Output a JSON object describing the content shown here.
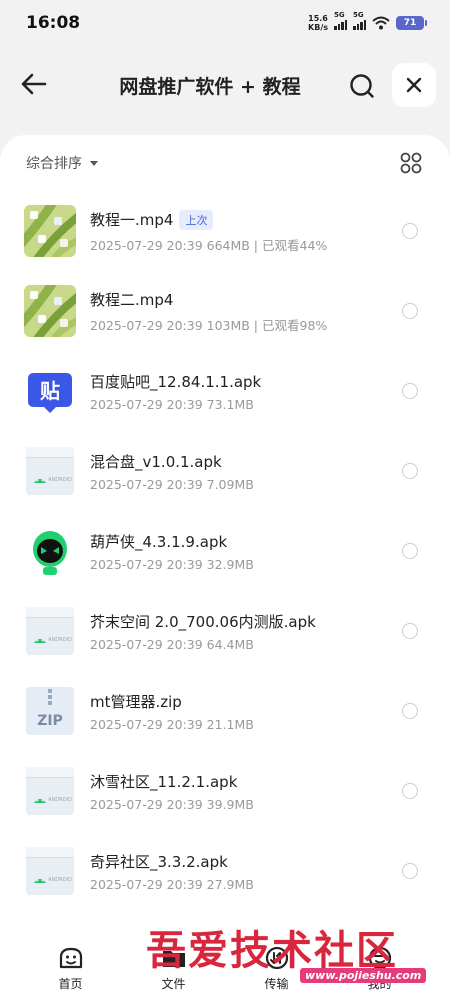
{
  "status": {
    "time": "16:08",
    "net_speed_value": "15.6",
    "net_speed_unit": "KB/s",
    "sim1": "5G",
    "sim2": "5G",
    "battery": "71"
  },
  "header": {
    "title": "网盘推广软件 + 教程"
  },
  "sort": {
    "label": "综合排序"
  },
  "files": [
    {
      "name": "教程一.mp4",
      "tag": "上次",
      "info": "2025-07-29 20:39  664MB | 已观看44%",
      "type": "video"
    },
    {
      "name": "教程二.mp4",
      "tag": "",
      "info": "2025-07-29 20:39  103MB | 已观看98%",
      "type": "video"
    },
    {
      "name": "百度贴吧_12.84.1.1.apk",
      "tag": "",
      "info": "2025-07-29 20:39  73.1MB",
      "type": "tieba"
    },
    {
      "name": "混合盘_v1.0.1.apk",
      "tag": "",
      "info": "2025-07-29 20:39  7.09MB",
      "type": "apk"
    },
    {
      "name": "葫芦侠_4.3.1.9.apk",
      "tag": "",
      "info": "2025-07-29 20:39  32.9MB",
      "type": "huluxia"
    },
    {
      "name": "芥末空间 2.0_700.06内测版.apk",
      "tag": "",
      "info": "2025-07-29 20:39  64.4MB",
      "type": "apk"
    },
    {
      "name": "mt管理器.zip",
      "tag": "",
      "info": "2025-07-29 20:39  21.1MB",
      "type": "zip"
    },
    {
      "name": "沐雪社区_11.2.1.apk",
      "tag": "",
      "info": "2025-07-29 20:39  39.9MB",
      "type": "apk"
    },
    {
      "name": "奇异社区_3.3.2.apk",
      "tag": "",
      "info": "2025-07-29 20:39  27.9MB",
      "type": "apk"
    }
  ],
  "icons": {
    "tieba_glyph": "贴",
    "apk_label": "ANDROID",
    "zip_label": "ZIP"
  },
  "nav": [
    {
      "label": "首页",
      "icon": "home-icon"
    },
    {
      "label": "文件",
      "icon": "folder-icon"
    },
    {
      "label": "传输",
      "icon": "transfer-icon"
    },
    {
      "label": "我的",
      "icon": "profile-icon"
    }
  ],
  "watermark": {
    "text": "吾爱技术社区",
    "url": "www.pojieshu.com"
  },
  "colors": {
    "accent": "#4a6ad8",
    "tag_bg": "#e6ecfc",
    "battery": "#5b67c8",
    "watermark": "#d7263d"
  }
}
